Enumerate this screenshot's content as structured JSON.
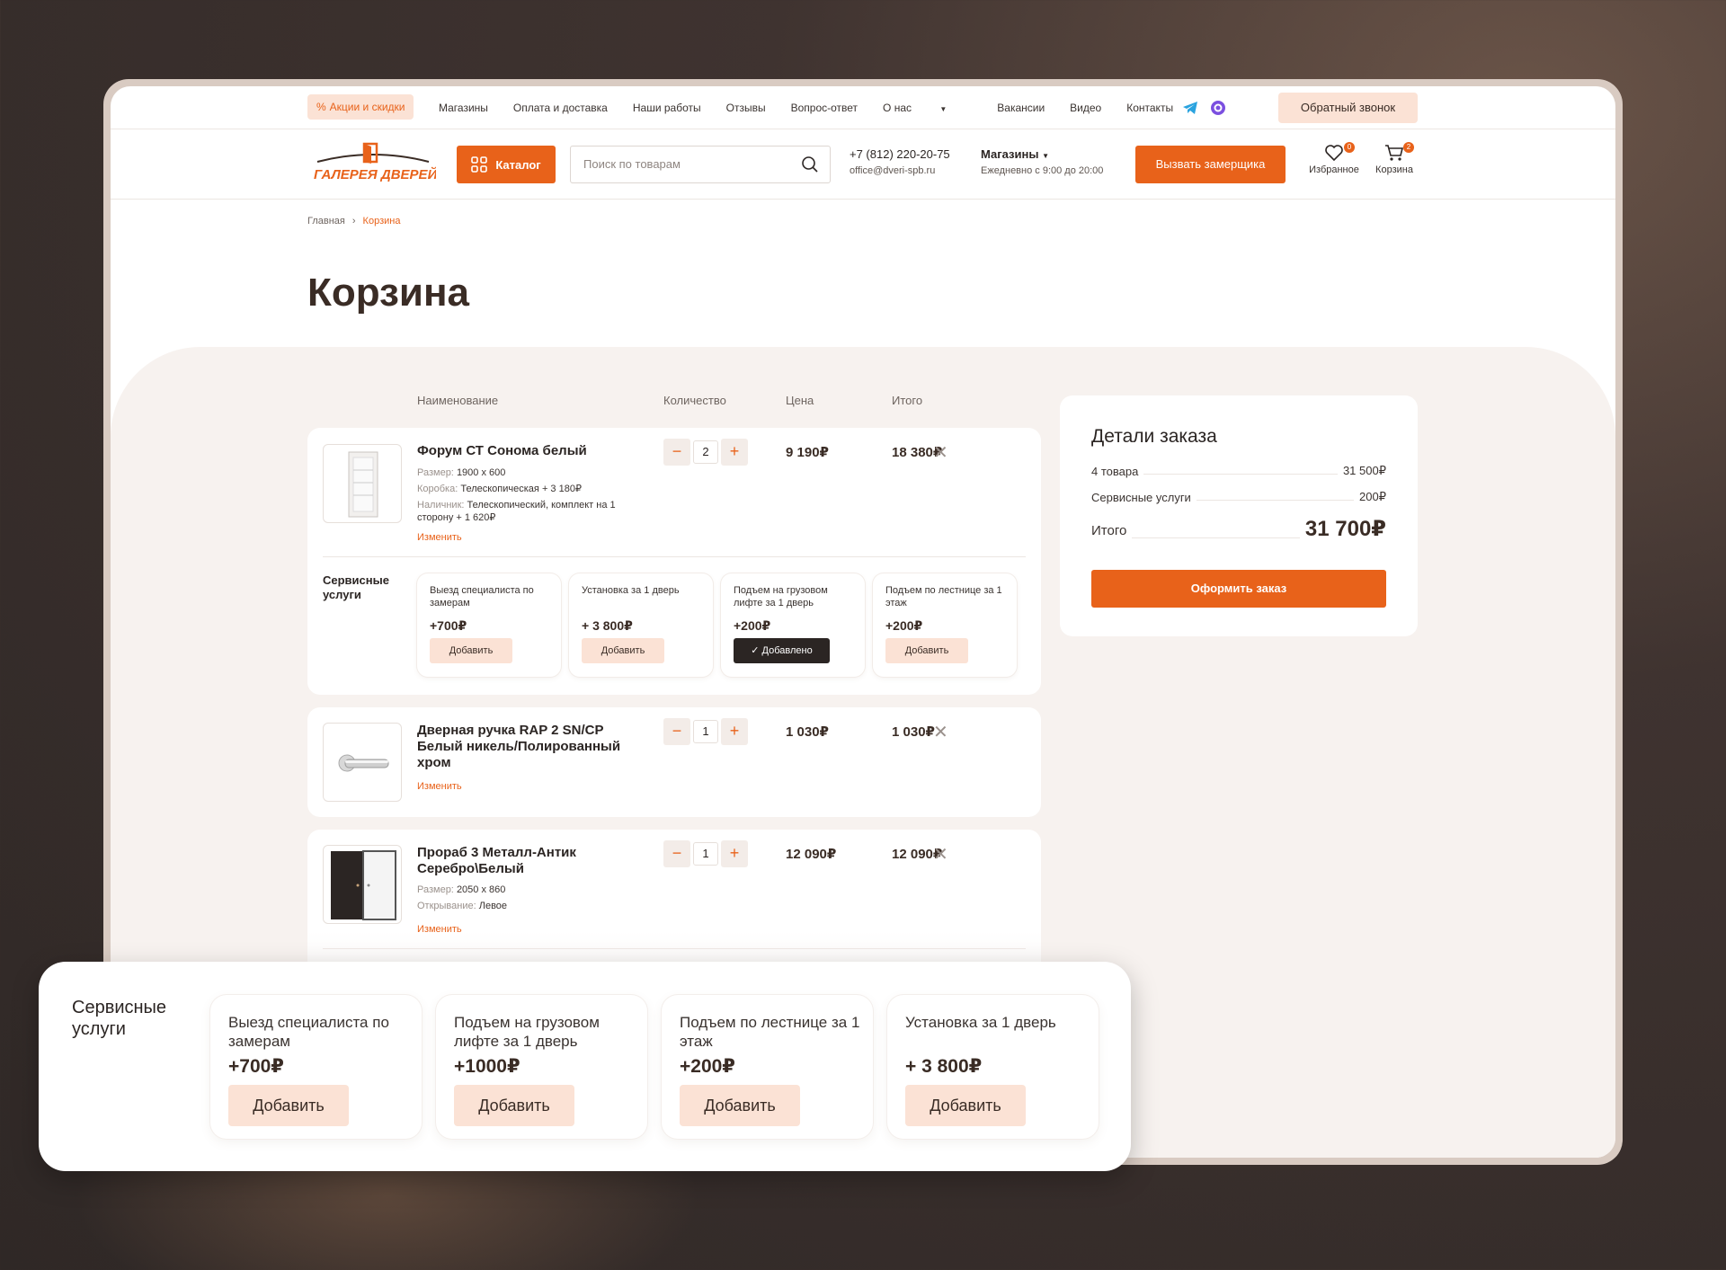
{
  "topnav": {
    "promo": "Акции и скидки",
    "links": [
      "Магазины",
      "Оплата и доставка",
      "Наши работы",
      "Отзывы",
      "Вопрос-ответ",
      "О нас",
      "Вакансии",
      "Видео",
      "Контакты"
    ],
    "callback": "Обратный звонок"
  },
  "header": {
    "logo_text": "ГАЛЕРЕЯ ДВЕРЕЙ",
    "catalog": "Каталог",
    "search_placeholder": "Поиск по товарам",
    "phone": "+7 (812) 220-20-75",
    "email": "office@dveri-spb.ru",
    "shops": "Магазины",
    "hours": "Ежедневно с 9:00 до 20:00",
    "measure": "Вызвать замерщика",
    "favorites": "Избранное",
    "favorites_count": "0",
    "cart": "Корзина",
    "cart_count": "2"
  },
  "breadcrumb": {
    "home": "Главная",
    "current": "Корзина"
  },
  "page_title": "Корзина",
  "columns": {
    "name": "Наименование",
    "qty": "Количество",
    "price": "Цена",
    "total": "Итого"
  },
  "items": [
    {
      "name": "Форум СТ Сонома белый",
      "attrs": [
        {
          "k": "Размер:",
          "v": "1900 х 600"
        },
        {
          "k": "Коробка:",
          "v": "Телескопическая + 3 180₽"
        },
        {
          "k": "Наличник:",
          "v": "Телескопический, комплект на 1 сторону + 1 620₽"
        }
      ],
      "change": "Изменить",
      "qty": "2",
      "price": "9 190₽",
      "total": "18 380₽"
    },
    {
      "name": "Дверная ручка RAP 2 SN/CP Белый никель/Полированный хром",
      "change": "Изменить",
      "qty": "1",
      "price": "1 030₽",
      "total": "1 030₽"
    },
    {
      "name": "Прораб 3 Металл-Антик Серебро\\Белый",
      "attrs": [
        {
          "k": "Размер:",
          "v": "2050 х 860"
        },
        {
          "k": "Открывание:",
          "v": "Левое"
        }
      ],
      "change": "Изменить",
      "qty": "1",
      "price": "12 090₽",
      "total": "12 090₽"
    }
  ],
  "services": {
    "title": "Сервисные услуги",
    "items": [
      {
        "title": "Выезд специалиста по замерам",
        "price": "+700₽",
        "button": "Добавить"
      },
      {
        "title": "Установка за 1 дверь",
        "price": "+ 3 800₽",
        "button": "Добавить"
      },
      {
        "title": "Подъем на грузовом лифте за 1 дверь",
        "price": "+200₽",
        "button": "Добавлено"
      },
      {
        "title": "Подъем по лестнице за 1 этаж",
        "price": "+200₽",
        "button": "Добавить"
      }
    ]
  },
  "order": {
    "title": "Детали заказа",
    "items_label": "4 товара",
    "items_value": "31 500₽",
    "services_label": "Сервисные услуги",
    "services_value": "200₽",
    "total_label": "Итого",
    "total_value": "31 700₽",
    "checkout": "Оформить заказ"
  },
  "zoom": {
    "title": "Сервисные услуги",
    "items": [
      {
        "title": "Выезд специалиста по замерам",
        "price": "+700₽",
        "button": "Добавить"
      },
      {
        "title": "Подъем на грузовом лифте за 1 дверь",
        "price": "+1000₽",
        "button": "Добавить"
      },
      {
        "title": "Подъем по лестнице за 1 этаж",
        "price": "+200₽",
        "button": "Добавить"
      },
      {
        "title": "Установка за 1 дверь",
        "price": "+ 3 800₽",
        "button": "Добавить"
      }
    ]
  },
  "colors": {
    "accent": "#e8621a",
    "accent_light": "#fbe2d5",
    "dark": "#2b2523",
    "page_bg": "#f7f2ef"
  }
}
